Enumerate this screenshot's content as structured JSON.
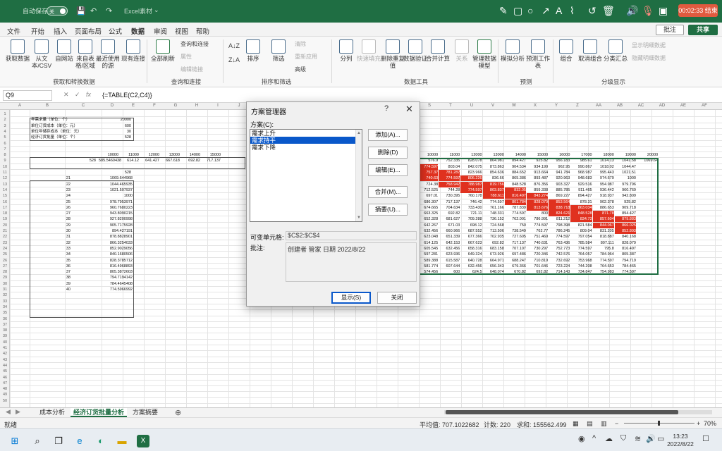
{
  "titlebar": {
    "autosave_label": "自动保存",
    "autosave_state": "关",
    "save_icon": "save-icon",
    "undo_icon": "undo-icon",
    "redo_icon": "redo-icon",
    "file_name": "Excel素材",
    "recording_timer": "00:02:33 结束"
  },
  "menu": {
    "tabs": [
      "文件",
      "开始",
      "插入",
      "页面布局",
      "公式",
      "数据",
      "审阅",
      "视图",
      "帮助"
    ],
    "active": "数据",
    "comment_btn": "批注",
    "share_btn": "共享"
  },
  "ribbon": {
    "get_data": "获取数据",
    "from_text": "从文本/CSV",
    "from_web": "自网站",
    "from_table": "来自表格/区域",
    "recent_sources": "最近使用的源",
    "existing_conn": "现有连接",
    "group1": "获取和转换数据",
    "refresh_all": "全部刷新",
    "queries_conn": "查询和连接",
    "properties": "属性",
    "edit_links": "编辑链接",
    "group2": "查询和连接",
    "sort_asc": "A↓Z",
    "sort_desc": "Z↓A",
    "sort": "排序",
    "filter": "筛选",
    "clear": "清除",
    "reapply": "重新应用",
    "advanced": "高级",
    "group3": "排序和筛选",
    "text_to_col": "分列",
    "flash_fill": "快速填充",
    "remove_dup": "删除重复值",
    "data_validation": "数据验证",
    "consolidate": "合并计算",
    "relationships": "关系",
    "data_model": "管理数据模型",
    "group4": "数据工具",
    "what_if": "模拟分析",
    "forecast_sheet": "预测工作表",
    "group5": "预测",
    "group_btn": "组合",
    "ungroup": "取消组合",
    "subtotal": "分类汇总",
    "show_detail": "显示明细数据",
    "hide_detail": "隐藏明细数据",
    "group6": "分级显示"
  },
  "formula_bar": {
    "name_box": "Q9",
    "formula": "{=TABLE(C2,C4)}"
  },
  "sheet": {
    "col_headers": [
      "A",
      "B",
      "C",
      "D",
      "E",
      "F",
      "G",
      "H",
      "I",
      "J",
      "K",
      "L",
      "M",
      "N",
      "O",
      "P",
      "Q",
      "R",
      "S",
      "T",
      "U",
      "V",
      "W",
      "X",
      "Y",
      "Z",
      "AA",
      "AB",
      "AC",
      "AD",
      "AE",
      "AF",
      "AG"
    ],
    "param_labels": [
      "年需求量（单位：个）",
      "单位订货成本（单位：元）",
      "单位年储存成本（单位：元）",
      "经济订货批量（单位：个）"
    ],
    "param_values": [
      "20000",
      "600",
      "30",
      "528"
    ],
    "row8_headers": [
      "10000",
      "11000",
      "12000",
      "13000",
      "14000",
      "15000"
    ],
    "row9_label": "528",
    "row9_values": [
      "585.5460438",
      "614.12",
      "641.427",
      "667.618",
      "692.82",
      "717.137"
    ],
    "c11": "528",
    "b_values": [
      "21",
      "22",
      "23",
      "24",
      "25",
      "26",
      "27",
      "28",
      "29",
      "30",
      "31",
      "32",
      "33",
      "34",
      "35",
      "36",
      "37",
      "38",
      "39",
      "40"
    ],
    "c_values": [
      "1069.644968",
      "1044.465935",
      "1021.507937",
      "1000",
      "978.7953971",
      "960.7680223",
      "943.8090215",
      "927.8200998",
      "905.7175928",
      "894.427191",
      "878.8828901",
      "866.3254033",
      "852.9029056",
      "840.1680506",
      "828.3785712",
      "816.4968893",
      "805.3872603",
      "794.7194142",
      "784.4645408",
      "774.5966992"
    ],
    "right_headers": [
      "10000",
      "11000",
      "12000",
      "13000",
      "14000",
      "15000",
      "16000",
      "17000",
      "18000",
      "19000",
      "20000"
    ],
    "right_rows": [
      [
        "576.9",
        "752.335",
        "828.078",
        "864.981",
        "894.427",
        "925.82",
        "956.183",
        "985.61",
        "1014.13",
        "1041.58",
        "1069.64"
      ],
      [
        "774.597",
        "803.04",
        "842.075",
        "873.863",
        "904.534",
        "934.199",
        "962.95",
        "990.867",
        "1018.02",
        "1044.47"
      ],
      [
        "757.37",
        "781.287",
        "823.966",
        "854.636",
        "884.652",
        "913.664",
        "941.784",
        "968.987",
        "995.443",
        "1021.51"
      ],
      [
        "740.63",
        "774.597",
        "806.226",
        "836.66",
        "865.386",
        "893.487",
        "920.963",
        "948.683",
        "974.679",
        "1000"
      ],
      [
        "724.38",
        "758.947",
        "788.987",
        "819.756",
        "848.528",
        "876.356",
        "903.327",
        "929.516",
        "954.987",
        "979.796"
      ],
      [
        "712.525",
        "744.28",
        "774.597",
        "803.837",
        "832.05",
        "859.338",
        "885.785",
        "911.465",
        "936.442",
        "960.769"
      ],
      [
        "697.01",
        "730.395",
        "760.178",
        "788.611",
        "816.497",
        "843.274",
        "869.227",
        "894.427",
        "918.937",
        "942.809"
      ],
      [
        "686.307",
        "717.137",
        "746.42",
        "774.597",
        "801.784",
        "828.079",
        "853.564",
        "878.31",
        "902.378",
        "925.82"
      ],
      [
        "674.665",
        "704.634",
        "733.430",
        "761.166",
        "787.839",
        "813.676",
        "838.718",
        "863.034",
        "886.653",
        "909.718"
      ],
      [
        "663.325",
        "692.82",
        "721.11",
        "748.331",
        "774.597",
        "800",
        "824.621",
        "848.528",
        "871.78",
        "894.427"
      ],
      [
        "652.328",
        "681.627",
        "709.288",
        "736.152",
        "762.001",
        "786.991",
        "811.212",
        "834.73",
        "857.604",
        "879.883"
      ],
      [
        "642.267",
        "671.03",
        "698.12",
        "724.568",
        "750",
        "774.597",
        "798.398",
        "821.584",
        "844.067",
        "866.025"
      ],
      [
        "632.456",
        "660.966",
        "687.552",
        "713.506",
        "738.549",
        "762.77",
        "786.245",
        "809.04",
        "831.205",
        "852.803"
      ],
      [
        "623.048",
        "651.339",
        "677.366",
        "702.935",
        "727.605",
        "751.469",
        "774.597",
        "797.054",
        "818.887",
        "840.168"
      ],
      [
        "614.125",
        "642.153",
        "667.623",
        "692.82",
        "717.137",
        "740.631",
        "763.436",
        "785.584",
        "807.111",
        "828.079"
      ],
      [
        "605.545",
        "632.456",
        "658.316",
        "683.158",
        "707.107",
        "730.297",
        "752.773",
        "774.597",
        "795.8",
        "816.497"
      ],
      [
        "597.281",
        "623.936",
        "649.324",
        "673.926",
        "697.486",
        "720.346",
        "742.576",
        "764.057",
        "784.964",
        "805.387"
      ],
      [
        "589.388",
        "615.587",
        "640.728",
        "664.971",
        "688.247",
        "710.819",
        "732.692",
        "753.968",
        "774.597",
        "794.719"
      ],
      [
        "581.774",
        "607.644",
        "632.456",
        "656.343",
        "679.366",
        "701.646",
        "723.224",
        "744.208",
        "764.653",
        "784.465"
      ],
      [
        "574.456",
        "600",
        "624.5",
        "648.074",
        "670.82",
        "692.82",
        "714.143",
        "734.847",
        "754.983",
        "774.597"
      ]
    ],
    "tabs": [
      "成本分析",
      "经济订货批量分析",
      "方案摘要"
    ],
    "active_tab": "经济订货批量分析",
    "add_sheet_icon": "plus-icon"
  },
  "status": {
    "ready": "就绪",
    "average": "平均值: 707.1022682",
    "count": "计数: 220",
    "sum": "求和: 155562.499",
    "zoom": "70%"
  },
  "taskbar": {
    "time": "13:23",
    "date": "2022/8/22"
  },
  "dialog": {
    "title": "方案管理器",
    "help": "?",
    "scenarios_label": "方案(C):",
    "scenarios": [
      "需求上升",
      "需求持平",
      "需求下降"
    ],
    "selected": "需求持平",
    "add": "添加(A)...",
    "delete": "删除(D)",
    "edit": "编辑(E)...",
    "merge": "合并(M)...",
    "summary": "摘要(U)...",
    "changing_cells_label": "可变单元格:",
    "changing_cells": "$C$2:$C$4",
    "comment_label": "批注:",
    "comment": "创建者 管家 日期 2022/8/22",
    "show": "显示(S)",
    "close": "关闭"
  },
  "colors": {
    "excel_green": "#1f6e43",
    "highlight_red": "#e0311f",
    "selection_blue": "#0a58ca"
  }
}
